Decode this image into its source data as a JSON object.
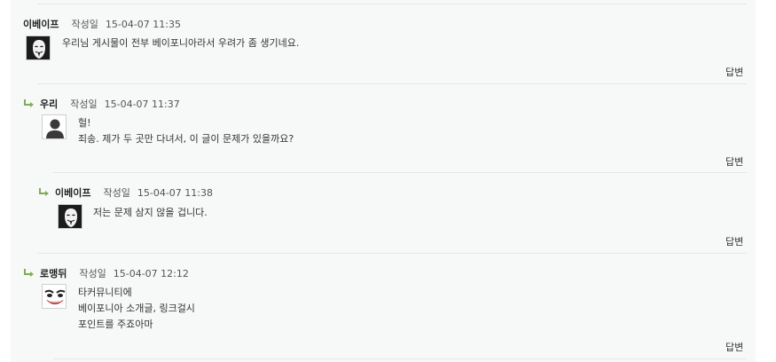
{
  "comments": [
    {
      "author": "이베이프",
      "date_label": "작성일",
      "date": "15-04-07 11:35",
      "lines": [
        "우리님 게시물이 전부 베이포니아라서 우려가 좀 생기네요."
      ],
      "reply_label": "답변"
    },
    {
      "author": "우리",
      "date_label": "작성일",
      "date": "15-04-07 11:37",
      "lines": [
        "헐!",
        "죄송. 제가 두 곳만 다녀서, 이 글이 문제가 있을까요?"
      ],
      "reply_label": "답변"
    },
    {
      "author": "이베이프",
      "date_label": "작성일",
      "date": "15-04-07 11:38",
      "lines": [
        "저는 문제 삼지 않을 겁니다."
      ],
      "reply_label": "답변"
    },
    {
      "author": "로맹뒤",
      "date_label": "작성일",
      "date": "15-04-07 12:12",
      "lines": [
        "타커뮤니티에",
        "베이포니아 소개글, 링크걸시",
        "포인트를 주죠아마"
      ],
      "reply_label": "답변"
    }
  ],
  "icons": {
    "reply_arrow": "reply-arrow-icon",
    "mask_avatar": "anonymous-mask-icon",
    "default_avatar": "default-user-icon",
    "joker_avatar": "joker-face-icon"
  },
  "colors": {
    "panel_bg": "#f7f8f8",
    "reply_arrow": "#7fae5a"
  }
}
